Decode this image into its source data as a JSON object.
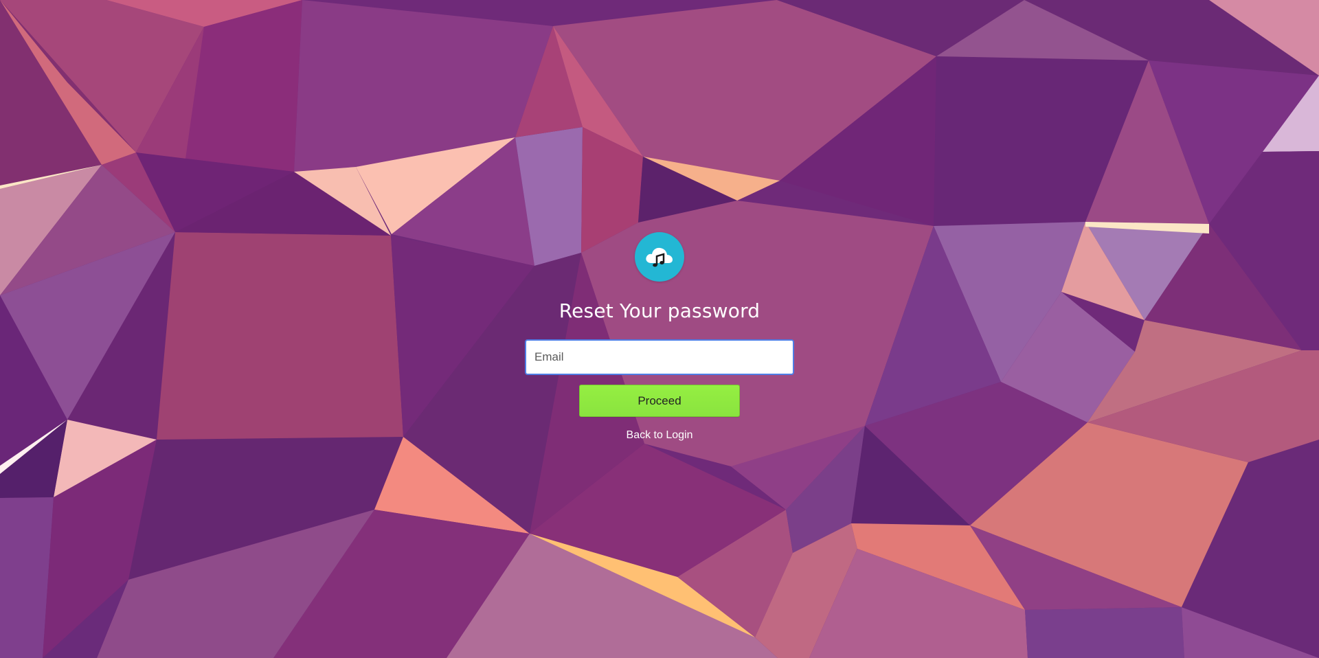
{
  "form": {
    "title": "Reset Your password",
    "email_placeholder": "Email",
    "email_value": "",
    "proceed_label": "Proceed",
    "back_link_label": "Back to Login"
  },
  "branding": {
    "logo_icon": "cloud-music-icon",
    "logo_color": "#23B7D4"
  },
  "colors": {
    "proceed_button": "#93EC41",
    "input_border": "#4F7EE6"
  }
}
